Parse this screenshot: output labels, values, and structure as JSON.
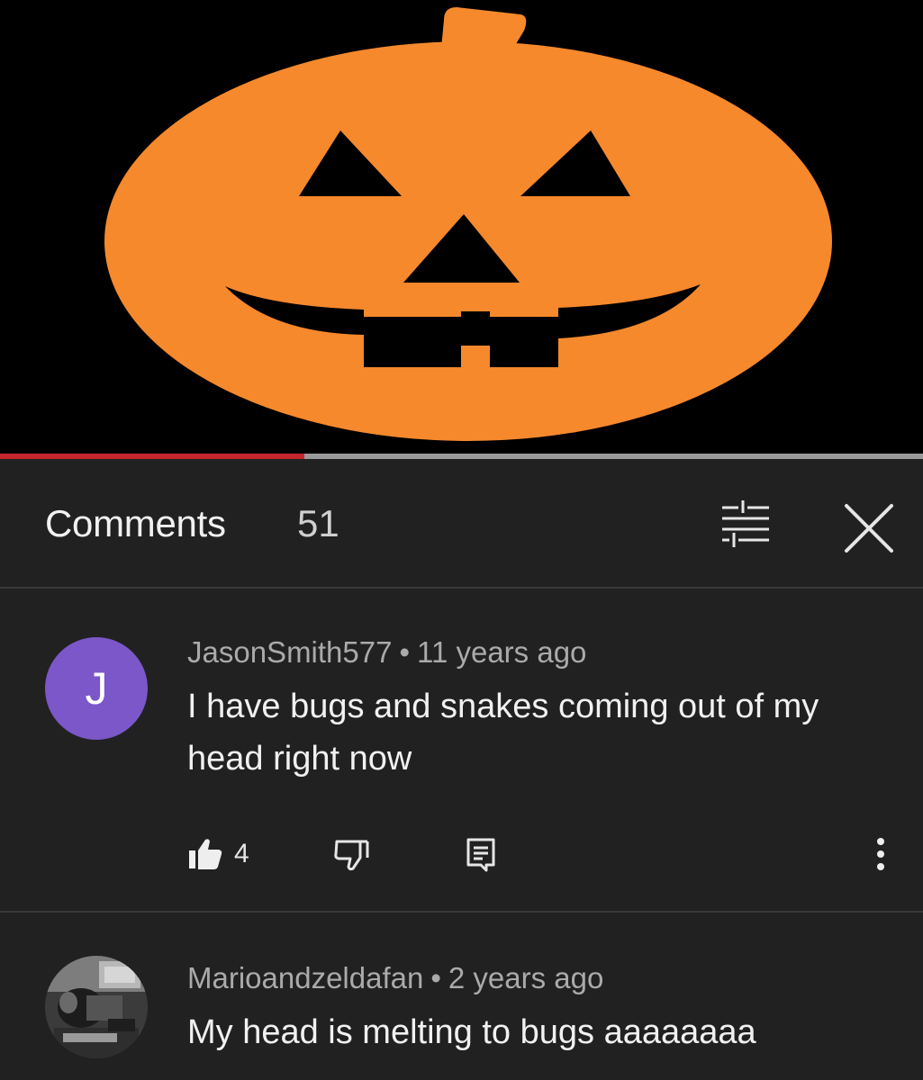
{
  "video": {
    "progress": 0.33,
    "colors": {
      "pumpkin": "#f6892c",
      "background": "#000000",
      "progress_played": "#c4262e",
      "progress_track": "#9a9a9a"
    }
  },
  "comments_panel": {
    "title": "Comments",
    "count": "51",
    "sort_icon": "sort-filter-icon",
    "close_icon": "close-icon",
    "items": [
      {
        "avatar_letter": "J",
        "avatar_color": "#7b57c9",
        "author": "JasonSmith577",
        "separator": "•",
        "time": "11 years ago",
        "text": "I have bugs and snakes coming out of my head right now",
        "likes": "4",
        "icons": [
          "thumbs-up-icon",
          "thumbs-down-icon",
          "reply-icon",
          "more-vertical-icon"
        ]
      },
      {
        "avatar_image": "profile-photo",
        "author": "Marioandzeldafan",
        "separator": "•",
        "time": "2 years ago",
        "text": "My head is melting to bugs aaaaaaaa"
      }
    ]
  }
}
